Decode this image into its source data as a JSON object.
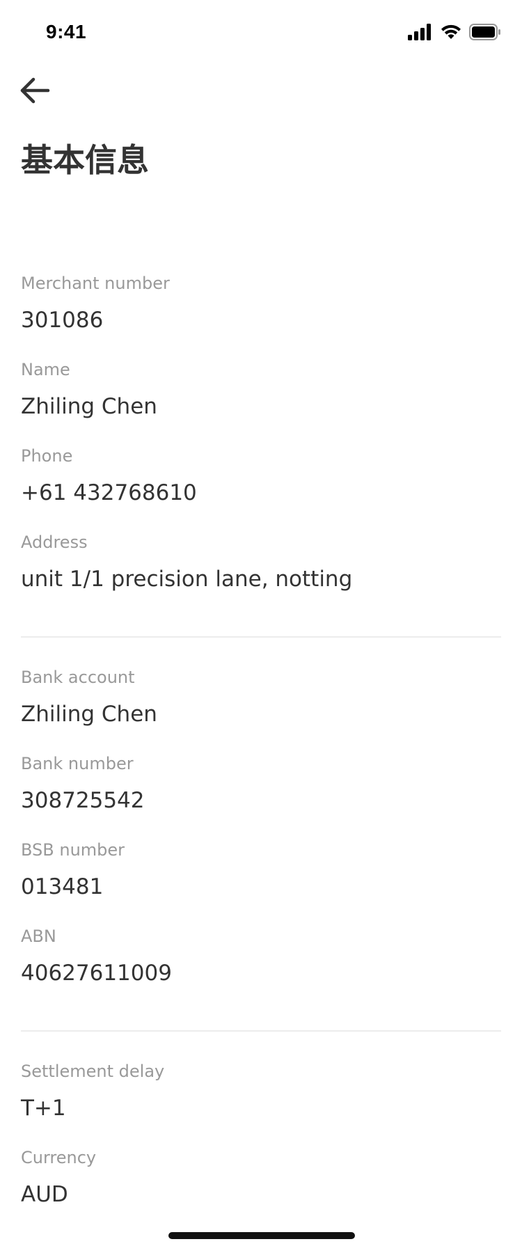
{
  "status_bar": {
    "time": "9:41",
    "icons": [
      "cellular-signal-icon",
      "wifi-icon",
      "battery-icon"
    ]
  },
  "header": {
    "back_icon": "arrow-left-icon",
    "title": "基本信息"
  },
  "sections": [
    {
      "fields": [
        {
          "label": "Merchant number",
          "value": "301086"
        },
        {
          "label": "Name",
          "value": "Zhiling Chen"
        },
        {
          "label": "Phone",
          "value": "+61 432768610"
        },
        {
          "label": "Address",
          "value": "unit 1/1 precision lane, notting"
        }
      ]
    },
    {
      "fields": [
        {
          "label": "Bank account",
          "value": "Zhiling Chen"
        },
        {
          "label": "Bank number",
          "value": "308725542"
        },
        {
          "label": "BSB number",
          "value": "013481"
        },
        {
          "label": "ABN",
          "value": "40627611009"
        }
      ]
    },
    {
      "fields": [
        {
          "label": "Settlement delay",
          "value": "T+1"
        },
        {
          "label": "Currency",
          "value": "AUD"
        }
      ]
    }
  ],
  "colors": {
    "label": "#999999",
    "value": "#333333",
    "divider": "#ececec",
    "background": "#ffffff"
  }
}
